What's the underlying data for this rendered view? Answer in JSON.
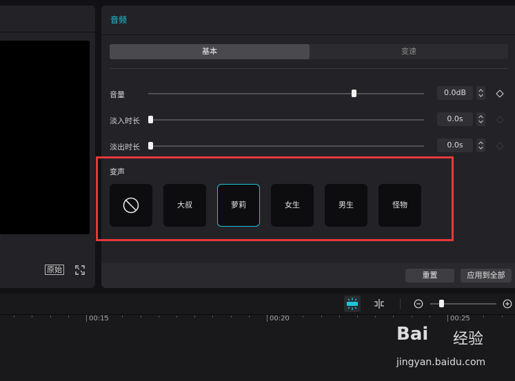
{
  "preview": {
    "original_label": "原始"
  },
  "audio": {
    "title": "音频",
    "tabs": [
      {
        "label": "基本",
        "active": true
      },
      {
        "label": "变速",
        "active": false
      }
    ],
    "rows": [
      {
        "label": "音量",
        "value": "0.0dB",
        "slider_fraction": 0.75
      },
      {
        "label": "淡入时长",
        "value": "0.0s",
        "slider_fraction": 0.0
      },
      {
        "label": "淡出时长",
        "value": "0.0s",
        "slider_fraction": 0.0
      }
    ],
    "voice_change": {
      "label": "变声",
      "options": [
        {
          "label": "",
          "icon": "none-icon",
          "selected": false
        },
        {
          "label": "大叔",
          "selected": false
        },
        {
          "label": "萝莉",
          "selected": true
        },
        {
          "label": "女生",
          "selected": false
        },
        {
          "label": "男生",
          "selected": false
        },
        {
          "label": "怪物",
          "selected": false
        }
      ]
    },
    "footer": {
      "reset_label": "重置",
      "apply_all_label": "应用到全部"
    }
  },
  "timeline": {
    "ruler_labels": [
      "00:15",
      "00:20",
      "00:25"
    ],
    "zoom_level_fraction": 0.15
  },
  "watermark": {
    "brand": "Bai",
    "brand_suffix": "经验",
    "url": "jingyan.baidu.com"
  },
  "colors": {
    "accent": "#1fc5d6",
    "highlight_box": "#e8383b",
    "panel": "#232327",
    "background": "#121215"
  }
}
